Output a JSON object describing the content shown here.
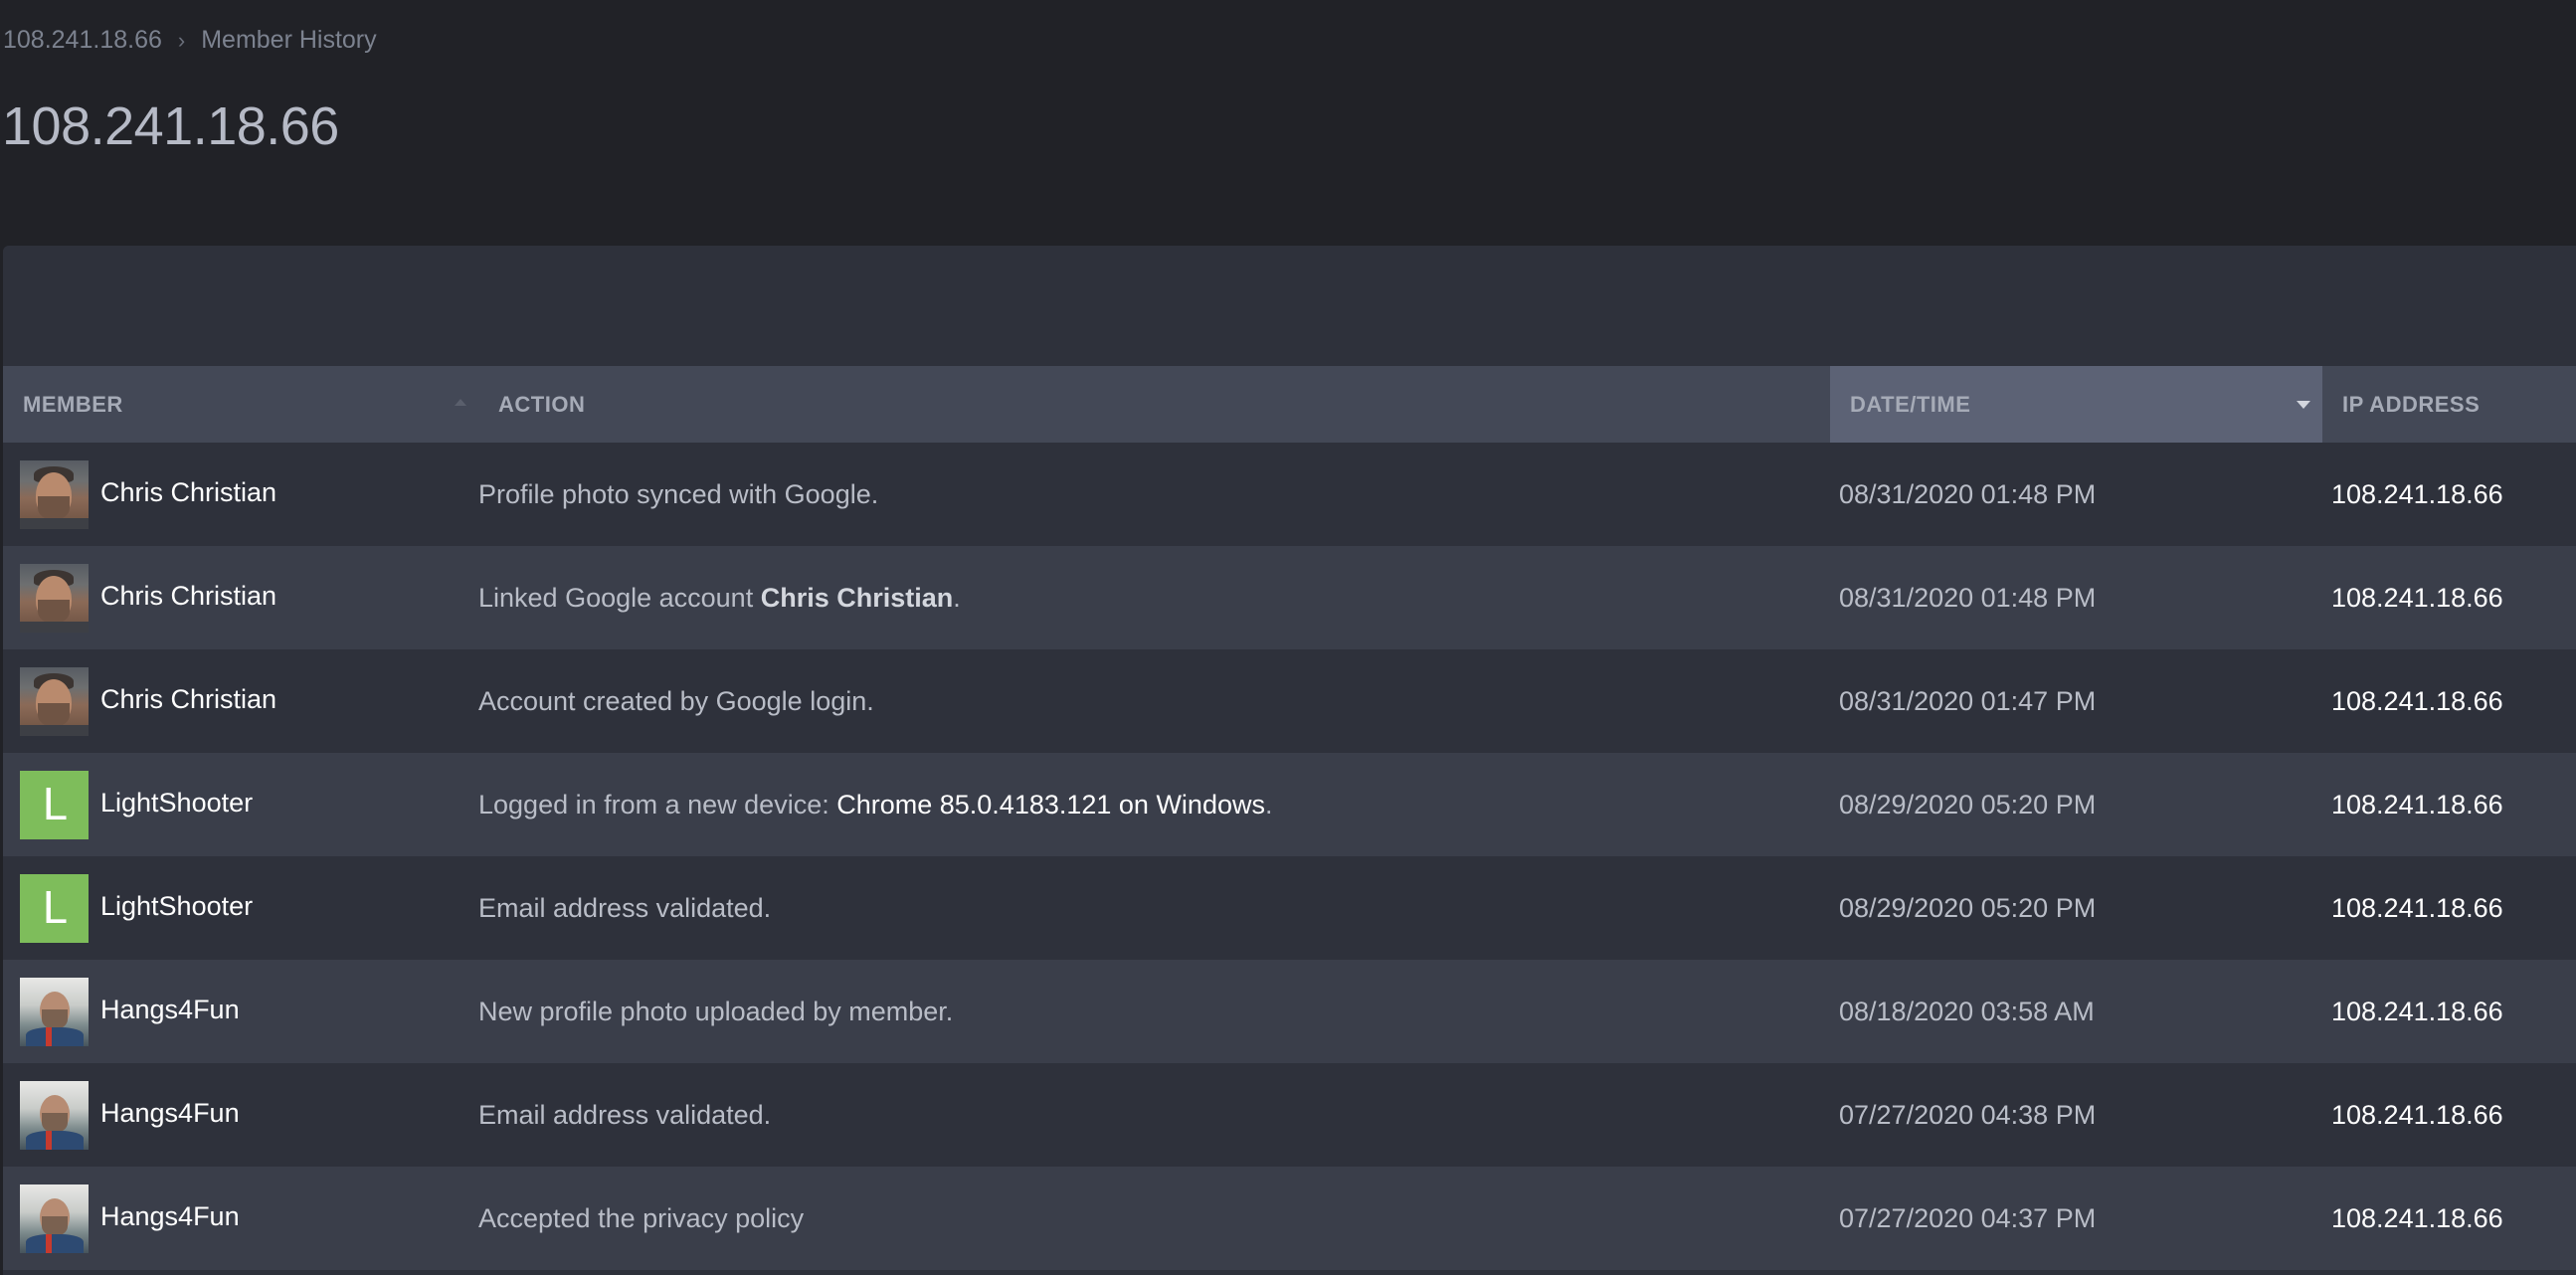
{
  "breadcrumb": {
    "items": [
      "108.241.18.66",
      "Member History"
    ],
    "separator": "›"
  },
  "page_title": "108.241.18.66",
  "table": {
    "columns": {
      "member": "MEMBER",
      "action": "ACTION",
      "datetime": "DATE/TIME",
      "ip": "IP ADDRESS"
    },
    "sorted_column": "datetime",
    "sort_direction": "descending",
    "rows": [
      {
        "member": "Chris Christian",
        "avatar": "photo-chris",
        "action_pre": "Profile photo synced with Google.",
        "action_highlight": "",
        "action_post": "",
        "datetime": "08/31/2020 01:48 PM",
        "ip": "108.241.18.66"
      },
      {
        "member": "Chris Christian",
        "avatar": "photo-chris",
        "action_pre": "Linked Google account ",
        "action_highlight": "Chris Christian",
        "action_post": ".",
        "datetime": "08/31/2020 01:48 PM",
        "ip": "108.241.18.66"
      },
      {
        "member": "Chris Christian",
        "avatar": "photo-chris",
        "action_pre": "Account created by Google login.",
        "action_highlight": "",
        "action_post": "",
        "datetime": "08/31/2020 01:47 PM",
        "ip": "108.241.18.66"
      },
      {
        "member": "LightShooter",
        "avatar": "initial",
        "avatar_initial": "L",
        "action_pre": "Logged in from a new device: ",
        "action_highlight": "Chrome 85.0.4183.121 on Windows",
        "action_post": ".",
        "datetime": "08/29/2020 05:20 PM",
        "ip": "108.241.18.66"
      },
      {
        "member": "LightShooter",
        "avatar": "initial",
        "avatar_initial": "L",
        "action_pre": "Email address validated.",
        "action_highlight": "",
        "action_post": "",
        "datetime": "08/29/2020 05:20 PM",
        "ip": "108.241.18.66"
      },
      {
        "member": "Hangs4Fun",
        "avatar": "photo-hangs",
        "action_pre": "New profile photo uploaded by member.",
        "action_highlight": "",
        "action_post": "",
        "datetime": "08/18/2020 03:58 AM",
        "ip": "108.241.18.66"
      },
      {
        "member": "Hangs4Fun",
        "avatar": "photo-hangs",
        "action_pre": "Email address validated.",
        "action_highlight": "",
        "action_post": "",
        "datetime": "07/27/2020 04:38 PM",
        "ip": "108.241.18.66"
      },
      {
        "member": "Hangs4Fun",
        "avatar": "photo-hangs",
        "action_pre": "Accepted the privacy policy",
        "action_highlight": "",
        "action_post": "",
        "datetime": "07/27/2020 04:37 PM",
        "ip": "108.241.18.66"
      }
    ]
  },
  "colors": {
    "background": "#212227",
    "panel": "#2e313b",
    "row_alt": "#3a3e4a",
    "header": "#434856",
    "header_sorted": "#5c6275",
    "initial_avatar": "#7ebd5b"
  }
}
